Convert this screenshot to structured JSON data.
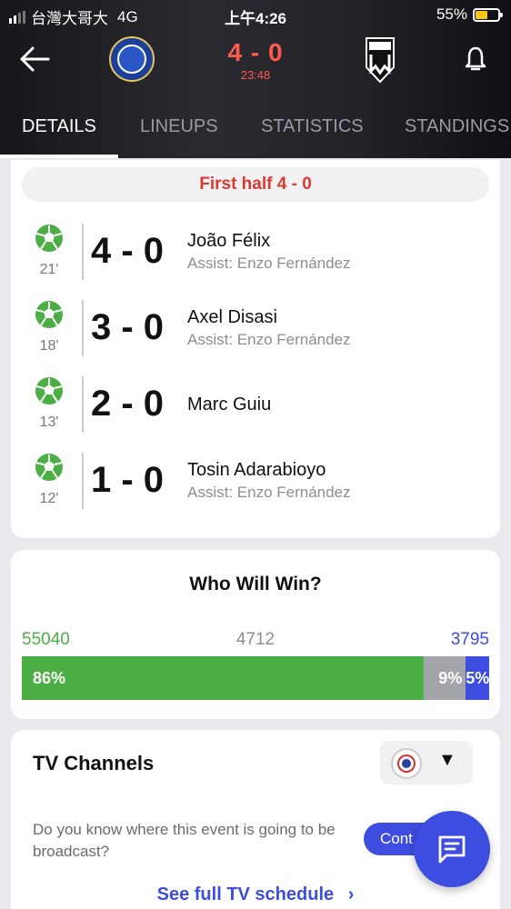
{
  "status_bar": {
    "carrier": "台灣大哥大",
    "network": "4G",
    "time": "上午4:26",
    "battery": "55%"
  },
  "match": {
    "score": "4 - 0",
    "clock": "23:48",
    "home_team_icon": "chelsea-crest",
    "away_team_icon": "noah-crest"
  },
  "tabs": [
    {
      "label": "DETAILS",
      "active": true
    },
    {
      "label": "LINEUPS",
      "active": false
    },
    {
      "label": "STATISTICS",
      "active": false
    },
    {
      "label": "STANDINGS",
      "active": false
    }
  ],
  "half_title": "First half 4 - 0",
  "goals": [
    {
      "minute": "21'",
      "score": "4 - 0",
      "scorer": "João Félix",
      "assist": "Assist: Enzo Fernández"
    },
    {
      "minute": "18'",
      "score": "3 - 0",
      "scorer": "Axel Disasi",
      "assist": "Assist: Enzo Fernández"
    },
    {
      "minute": "13'",
      "score": "2 - 0",
      "scorer": "Marc Guiu",
      "assist": ""
    },
    {
      "minute": "12'",
      "score": "1 - 0",
      "scorer": "Tosin Adarabioyo",
      "assist": "Assist: Enzo Fernández"
    }
  ],
  "vote": {
    "title": "Who Will Win?",
    "home_votes": "55040",
    "draw_votes": "4712",
    "away_votes": "3795",
    "home_pct": "86%",
    "draw_pct": "9%",
    "away_pct": "5%",
    "home_share": 86,
    "draw_share": 9,
    "away_share": 5,
    "colors": {
      "home": "#4caf45",
      "draw": "#a4a4ab",
      "away": "#3d4de0"
    }
  },
  "tv": {
    "title": "TV Channels",
    "description": "Do you know where this event is going to be broadcast?",
    "contact_label": "Cont",
    "schedule_link": "See full TV schedule",
    "chevron": "›"
  }
}
